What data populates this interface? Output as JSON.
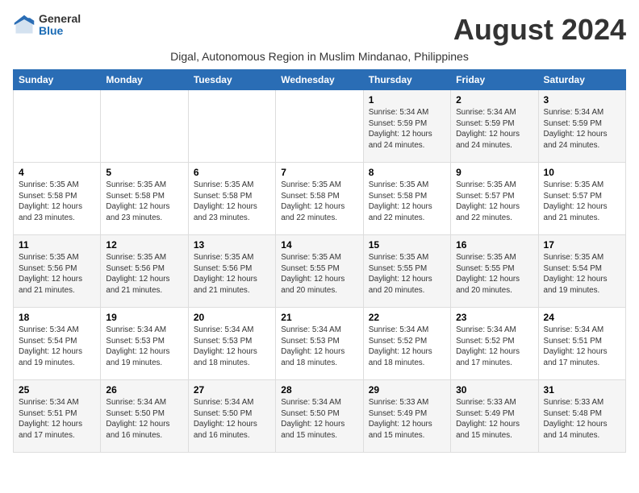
{
  "logo": {
    "general": "General",
    "blue": "Blue"
  },
  "title": "August 2024",
  "subtitle": "Digal, Autonomous Region in Muslim Mindanao, Philippines",
  "weekdays": [
    "Sunday",
    "Monday",
    "Tuesday",
    "Wednesday",
    "Thursday",
    "Friday",
    "Saturday"
  ],
  "weeks": [
    [
      {
        "day": "",
        "info": ""
      },
      {
        "day": "",
        "info": ""
      },
      {
        "day": "",
        "info": ""
      },
      {
        "day": "",
        "info": ""
      },
      {
        "day": "1",
        "info": "Sunrise: 5:34 AM\nSunset: 5:59 PM\nDaylight: 12 hours and 24 minutes."
      },
      {
        "day": "2",
        "info": "Sunrise: 5:34 AM\nSunset: 5:59 PM\nDaylight: 12 hours and 24 minutes."
      },
      {
        "day": "3",
        "info": "Sunrise: 5:34 AM\nSunset: 5:59 PM\nDaylight: 12 hours and 24 minutes."
      }
    ],
    [
      {
        "day": "4",
        "info": "Sunrise: 5:35 AM\nSunset: 5:58 PM\nDaylight: 12 hours and 23 minutes."
      },
      {
        "day": "5",
        "info": "Sunrise: 5:35 AM\nSunset: 5:58 PM\nDaylight: 12 hours and 23 minutes."
      },
      {
        "day": "6",
        "info": "Sunrise: 5:35 AM\nSunset: 5:58 PM\nDaylight: 12 hours and 23 minutes."
      },
      {
        "day": "7",
        "info": "Sunrise: 5:35 AM\nSunset: 5:58 PM\nDaylight: 12 hours and 22 minutes."
      },
      {
        "day": "8",
        "info": "Sunrise: 5:35 AM\nSunset: 5:58 PM\nDaylight: 12 hours and 22 minutes."
      },
      {
        "day": "9",
        "info": "Sunrise: 5:35 AM\nSunset: 5:57 PM\nDaylight: 12 hours and 22 minutes."
      },
      {
        "day": "10",
        "info": "Sunrise: 5:35 AM\nSunset: 5:57 PM\nDaylight: 12 hours and 21 minutes."
      }
    ],
    [
      {
        "day": "11",
        "info": "Sunrise: 5:35 AM\nSunset: 5:56 PM\nDaylight: 12 hours and 21 minutes."
      },
      {
        "day": "12",
        "info": "Sunrise: 5:35 AM\nSunset: 5:56 PM\nDaylight: 12 hours and 21 minutes."
      },
      {
        "day": "13",
        "info": "Sunrise: 5:35 AM\nSunset: 5:56 PM\nDaylight: 12 hours and 21 minutes."
      },
      {
        "day": "14",
        "info": "Sunrise: 5:35 AM\nSunset: 5:55 PM\nDaylight: 12 hours and 20 minutes."
      },
      {
        "day": "15",
        "info": "Sunrise: 5:35 AM\nSunset: 5:55 PM\nDaylight: 12 hours and 20 minutes."
      },
      {
        "day": "16",
        "info": "Sunrise: 5:35 AM\nSunset: 5:55 PM\nDaylight: 12 hours and 20 minutes."
      },
      {
        "day": "17",
        "info": "Sunrise: 5:35 AM\nSunset: 5:54 PM\nDaylight: 12 hours and 19 minutes."
      }
    ],
    [
      {
        "day": "18",
        "info": "Sunrise: 5:34 AM\nSunset: 5:54 PM\nDaylight: 12 hours and 19 minutes."
      },
      {
        "day": "19",
        "info": "Sunrise: 5:34 AM\nSunset: 5:53 PM\nDaylight: 12 hours and 19 minutes."
      },
      {
        "day": "20",
        "info": "Sunrise: 5:34 AM\nSunset: 5:53 PM\nDaylight: 12 hours and 18 minutes."
      },
      {
        "day": "21",
        "info": "Sunrise: 5:34 AM\nSunset: 5:53 PM\nDaylight: 12 hours and 18 minutes."
      },
      {
        "day": "22",
        "info": "Sunrise: 5:34 AM\nSunset: 5:52 PM\nDaylight: 12 hours and 18 minutes."
      },
      {
        "day": "23",
        "info": "Sunrise: 5:34 AM\nSunset: 5:52 PM\nDaylight: 12 hours and 17 minutes."
      },
      {
        "day": "24",
        "info": "Sunrise: 5:34 AM\nSunset: 5:51 PM\nDaylight: 12 hours and 17 minutes."
      }
    ],
    [
      {
        "day": "25",
        "info": "Sunrise: 5:34 AM\nSunset: 5:51 PM\nDaylight: 12 hours and 17 minutes."
      },
      {
        "day": "26",
        "info": "Sunrise: 5:34 AM\nSunset: 5:50 PM\nDaylight: 12 hours and 16 minutes."
      },
      {
        "day": "27",
        "info": "Sunrise: 5:34 AM\nSunset: 5:50 PM\nDaylight: 12 hours and 16 minutes."
      },
      {
        "day": "28",
        "info": "Sunrise: 5:34 AM\nSunset: 5:50 PM\nDaylight: 12 hours and 15 minutes."
      },
      {
        "day": "29",
        "info": "Sunrise: 5:33 AM\nSunset: 5:49 PM\nDaylight: 12 hours and 15 minutes."
      },
      {
        "day": "30",
        "info": "Sunrise: 5:33 AM\nSunset: 5:49 PM\nDaylight: 12 hours and 15 minutes."
      },
      {
        "day": "31",
        "info": "Sunrise: 5:33 AM\nSunset: 5:48 PM\nDaylight: 12 hours and 14 minutes."
      }
    ]
  ]
}
